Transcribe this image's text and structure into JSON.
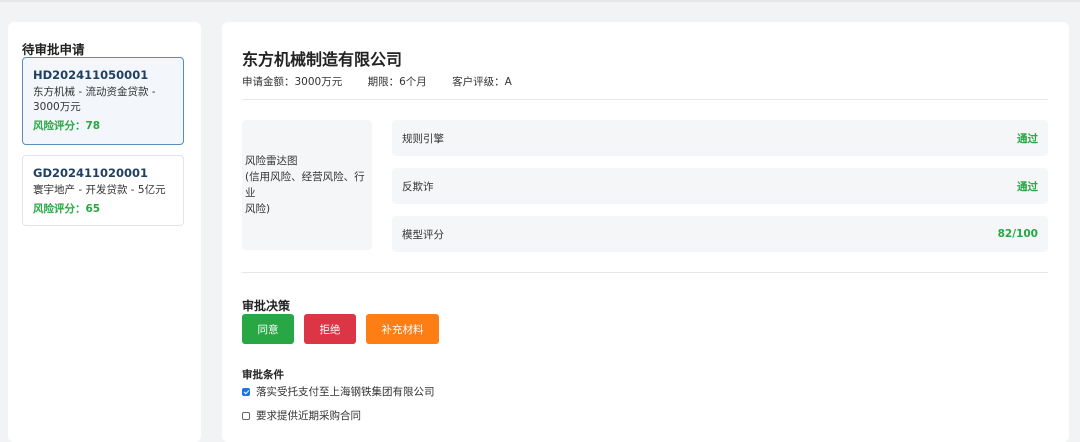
{
  "sidebar": {
    "title": "待审批申请",
    "applications": [
      {
        "id": "HD202411050001",
        "desc_line1": "东方机械 - 流动资金贷款 -",
        "desc_line2": "3000万元",
        "risk": "风险评分：78",
        "active": true
      },
      {
        "id": "GD202411020001",
        "desc_line1": "寰宇地产 - 开发贷款 - 5亿元",
        "risk": "风险评分：65",
        "active": false
      }
    ]
  },
  "main": {
    "company": "东方机械制造有限公司",
    "meta": {
      "amount": "申请金额：3000万元",
      "term": "期限：6个月",
      "rating": "客户评级：A"
    },
    "radar": {
      "line1": "风险雷达图",
      "line2": "(信用风险、经营风险、行业",
      "line3": "风险)"
    },
    "checks": [
      {
        "label": "规则引擎",
        "value": "通过"
      },
      {
        "label": "反欺诈",
        "value": "通过"
      },
      {
        "label": "模型评分",
        "value": "82/100"
      }
    ],
    "decision": {
      "title": "审批决策",
      "agree": "同意",
      "reject": "拒绝",
      "supplement": "补充材料"
    },
    "conditions": {
      "title": "审批条件",
      "items": [
        {
          "label": "落实受托支付至上海钢铁集团有限公司",
          "checked": true
        },
        {
          "label": "要求提供近期采购合同",
          "checked": false
        }
      ]
    }
  },
  "colors": {
    "pass": "#28a745",
    "agree": "#28a745",
    "reject": "#dc3545",
    "supplement": "#fd7e14",
    "active_border": "#5b8db8"
  }
}
